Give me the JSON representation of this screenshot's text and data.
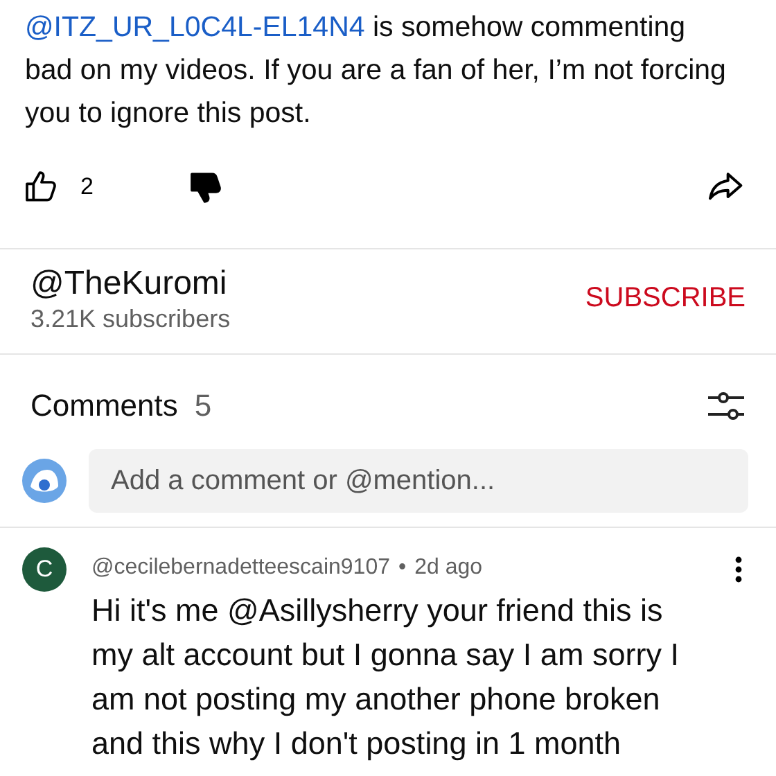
{
  "post": {
    "text_mention": "@ITZ_UR_L0C4L-EL14N4",
    "text_rest": " is somehow commenting bad on my videos. If you are a fan of her, I’m not forcing you to ignore this post.",
    "like_count": "2",
    "liked": false,
    "disliked": true
  },
  "channel": {
    "name": "@TheKuromi",
    "subscribers": "3.21K subscribers",
    "subscribe_label": "SUBSCRIBE"
  },
  "comments": {
    "title": "Comments",
    "count": "5",
    "input": {
      "placeholder": "Add a comment or @mention..."
    },
    "items": [
      {
        "avatar_letter": "C",
        "color": "#1e5a3c",
        "author": "@cecilebernadetteescain9107",
        "separator": "•",
        "time": "2d ago",
        "text": "Hi it's me @Asillysherry your friend this is my alt account but I gonna say I am sorry I am not posting my another phone broken and this why I don't posting in 1 month"
      }
    ]
  }
}
